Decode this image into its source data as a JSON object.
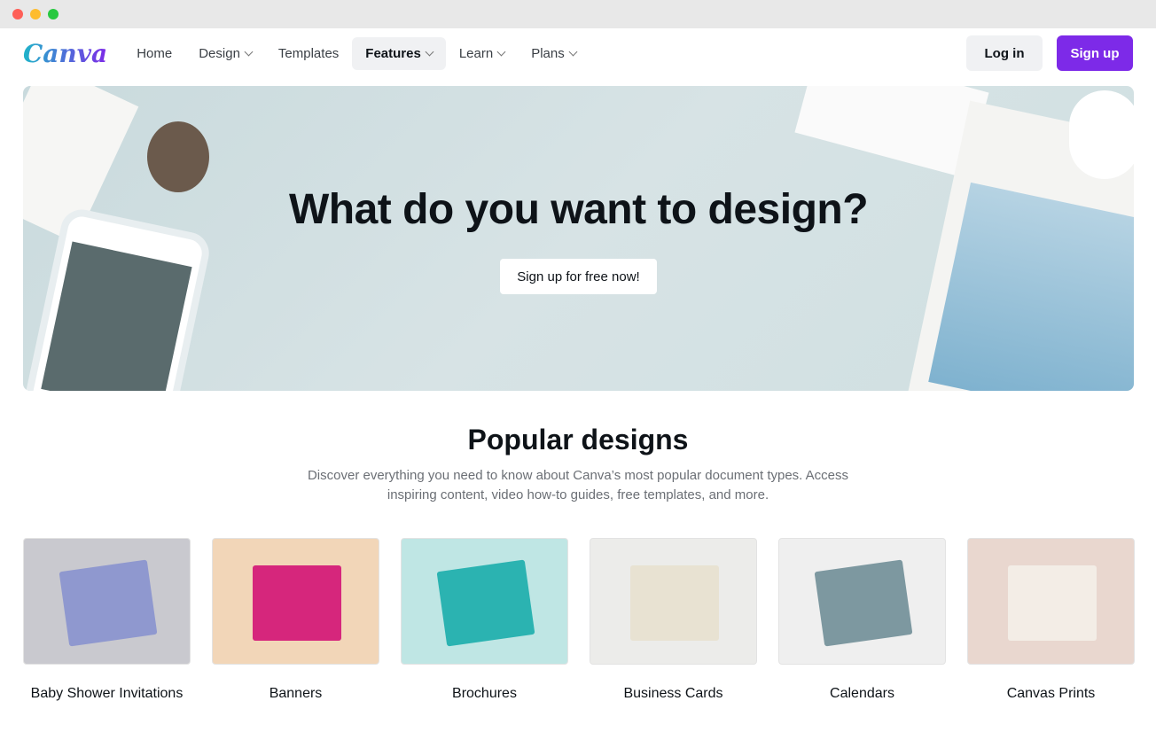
{
  "nav": {
    "logo": "Canva",
    "items": [
      {
        "label": "Home",
        "dropdown": false
      },
      {
        "label": "Design",
        "dropdown": true
      },
      {
        "label": "Templates",
        "dropdown": false
      },
      {
        "label": "Features",
        "dropdown": true,
        "active": true
      },
      {
        "label": "Learn",
        "dropdown": true
      },
      {
        "label": "Plans",
        "dropdown": true
      }
    ],
    "login": "Log in",
    "signup": "Sign up"
  },
  "hero": {
    "title": "What do you want to design?",
    "cta": "Sign up for free now!"
  },
  "popular": {
    "title": "Popular designs",
    "description": "Discover everything you need to know about Canva’s most popular document types. Access inspiring content, video how-to guides, free templates, and more.",
    "cards": [
      {
        "label": "Baby Shower Invitations",
        "color": "#c9c9cf",
        "accent": "#8f98cf"
      },
      {
        "label": "Banners",
        "color": "#f2d6b8",
        "accent": "#d6267c"
      },
      {
        "label": "Brochures",
        "color": "#bfe6e4",
        "accent": "#2bb3b1"
      },
      {
        "label": "Business Cards",
        "color": "#ececea",
        "accent": "#e8e2d2"
      },
      {
        "label": "Calendars",
        "color": "#efefef",
        "accent": "#7d98a0"
      },
      {
        "label": "Canvas Prints",
        "color": "#e9d7cf",
        "accent": "#f3ede6"
      }
    ]
  },
  "colors": {
    "brand": "#7d2ae8"
  }
}
